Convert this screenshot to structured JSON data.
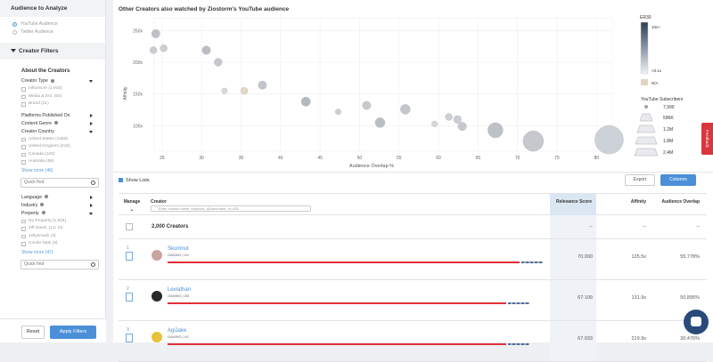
{
  "sidebar": {
    "audience_title": "Audience to Analyze",
    "audience_options": [
      {
        "label": "YouTube Audience",
        "selected": true
      },
      {
        "label": "Twitter Audience",
        "selected": false
      }
    ],
    "filters_title": "Creator Filters",
    "about_title": "About the Creators",
    "creator_type": {
      "label": "Creator Type",
      "items": [
        "Influencer (1,915)",
        "Media & Ent. (64)",
        "Brand (21)"
      ]
    },
    "platforms_label": "Platforms Published On",
    "content_genre_label": "Content Genre",
    "creator_country": {
      "label": "Creator Country",
      "items": [
        "United States (1380)",
        "United Kingdom (216)",
        "Canada (120)",
        "Australia (69)"
      ],
      "show_more": "Show more (46)"
    },
    "quick_find_1": "Quick find",
    "language_label": "Language",
    "industry_label": "Industry",
    "property": {
      "label": "Property",
      "items": [
        "No Property (1,934)",
        "Ziff Davis, LLC (3)",
        "Jellysmack (3)",
        "Conde Nast (3)"
      ],
      "show_more": "Show more (47)"
    },
    "quick_find_2": "Quick find",
    "reset_label": "Reset",
    "apply_label": "Apply Filters"
  },
  "chart": {
    "title": "Other Creators also watched by Ziostorm's YouTube audience",
    "xlabel": "Audience Overlap %",
    "ylabel": "Affinity",
    "er30_title": "ER30",
    "er30_top": "10x+",
    "er30_bottom": "<0.1x",
    "na_label": "N/A",
    "subs_title": "YouTube Subscribers",
    "subs_values": [
      "7,990",
      "596K",
      "1.2M",
      "1.8M",
      "2.4M"
    ]
  },
  "chart_data": {
    "type": "scatter",
    "title": "Other Creators also watched by Ziostorm's YouTube audience",
    "xlabel": "Audience Overlap %",
    "ylabel": "Affinity",
    "x_ticks": [
      "25",
      "30",
      "35",
      "40",
      "45",
      "50",
      "55",
      "60",
      "65",
      "70",
      "75",
      "80"
    ],
    "y_ticks": [
      "250x",
      "200x",
      "150x",
      "100x"
    ],
    "xlim": [
      24,
      82
    ],
    "ylim": [
      60,
      270
    ],
    "points": [
      {
        "x": 24.2,
        "y": 245,
        "size": 0.15,
        "color": "#b8bcc2"
      },
      {
        "x": 23.9,
        "y": 219,
        "size": 0.1,
        "color": "#c4c7cc"
      },
      {
        "x": 25.2,
        "y": 222,
        "size": 0.1,
        "color": "#c8cbcf"
      },
      {
        "x": 30.6,
        "y": 219,
        "size": 0.15,
        "color": "#b4b8be"
      },
      {
        "x": 32.1,
        "y": 200,
        "size": 0.13,
        "color": "#c0c3c8"
      },
      {
        "x": 35.4,
        "y": 155,
        "size": 0.1,
        "color": "#e3d3be"
      },
      {
        "x": 32.9,
        "y": 155,
        "size": 0.05,
        "color": "#d3d5d8"
      },
      {
        "x": 37.7,
        "y": 164,
        "size": 0.15,
        "color": "#bcc0c5"
      },
      {
        "x": 43.2,
        "y": 138,
        "size": 0.18,
        "color": "#aeb2b8"
      },
      {
        "x": 47.3,
        "y": 122,
        "size": 0.05,
        "color": "#c8cbcf"
      },
      {
        "x": 50.9,
        "y": 132,
        "size": 0.15,
        "color": "#c2c6ca"
      },
      {
        "x": 52.6,
        "y": 105,
        "size": 0.2,
        "color": "#b4b8be"
      },
      {
        "x": 55.8,
        "y": 126,
        "size": 0.2,
        "color": "#bdc1c6"
      },
      {
        "x": 59.5,
        "y": 103,
        "size": 0.05,
        "color": "#d0d3d6"
      },
      {
        "x": 61.3,
        "y": 114,
        "size": 0.1,
        "color": "#c8cbcf"
      },
      {
        "x": 62.4,
        "y": 110,
        "size": 0.13,
        "color": "#c4c7cc"
      },
      {
        "x": 63.0,
        "y": 99,
        "size": 0.15,
        "color": "#c0c3c8"
      },
      {
        "x": 67.2,
        "y": 93,
        "size": 0.4,
        "color": "#b8bcc2"
      },
      {
        "x": 72.0,
        "y": 76,
        "size": 0.6,
        "color": "#c0c3c8"
      },
      {
        "x": 81.6,
        "y": 78,
        "size": 0.9,
        "color": "#c8ced4"
      }
    ]
  },
  "table": {
    "show_lists": "Show Lists",
    "export_label": "Export",
    "columns_label": "Columns",
    "headers": {
      "manage": "Manage",
      "creator": "Creator",
      "relevance": "Relevance Score",
      "affinity": "Affinity",
      "overlap": "Audience Overlap"
    },
    "search_placeholder": "Enter creator name, keyword, @username, or URL",
    "summary": {
      "label": "2,000 Creators",
      "relevance": "--",
      "affinity": "--",
      "overlap": "--"
    },
    "rows": [
      {
        "rank": "1",
        "name": "Skumnut",
        "tag": "GAMING | US",
        "relevance": "70.000",
        "affinity": "125.5x",
        "overlap": "55.778%",
        "avatar_color": "#c9a5a0",
        "bar": 0.79
      },
      {
        "rank": "2",
        "name": "Leviathan",
        "tag": "GAMING | GB",
        "relevance": "67.109",
        "affinity": "131.9x",
        "overlap": "50.895%",
        "avatar_color": "#2a2a2a",
        "bar": 0.76
      },
      {
        "rank": "3",
        "name": "AgiJake",
        "tag": "GAMING | US",
        "relevance": "67.033",
        "affinity": "219.9x",
        "overlap": "30.476%",
        "avatar_color": "#e8c13a",
        "bar": 0.76
      }
    ]
  },
  "feedback_label": "Feedback"
}
